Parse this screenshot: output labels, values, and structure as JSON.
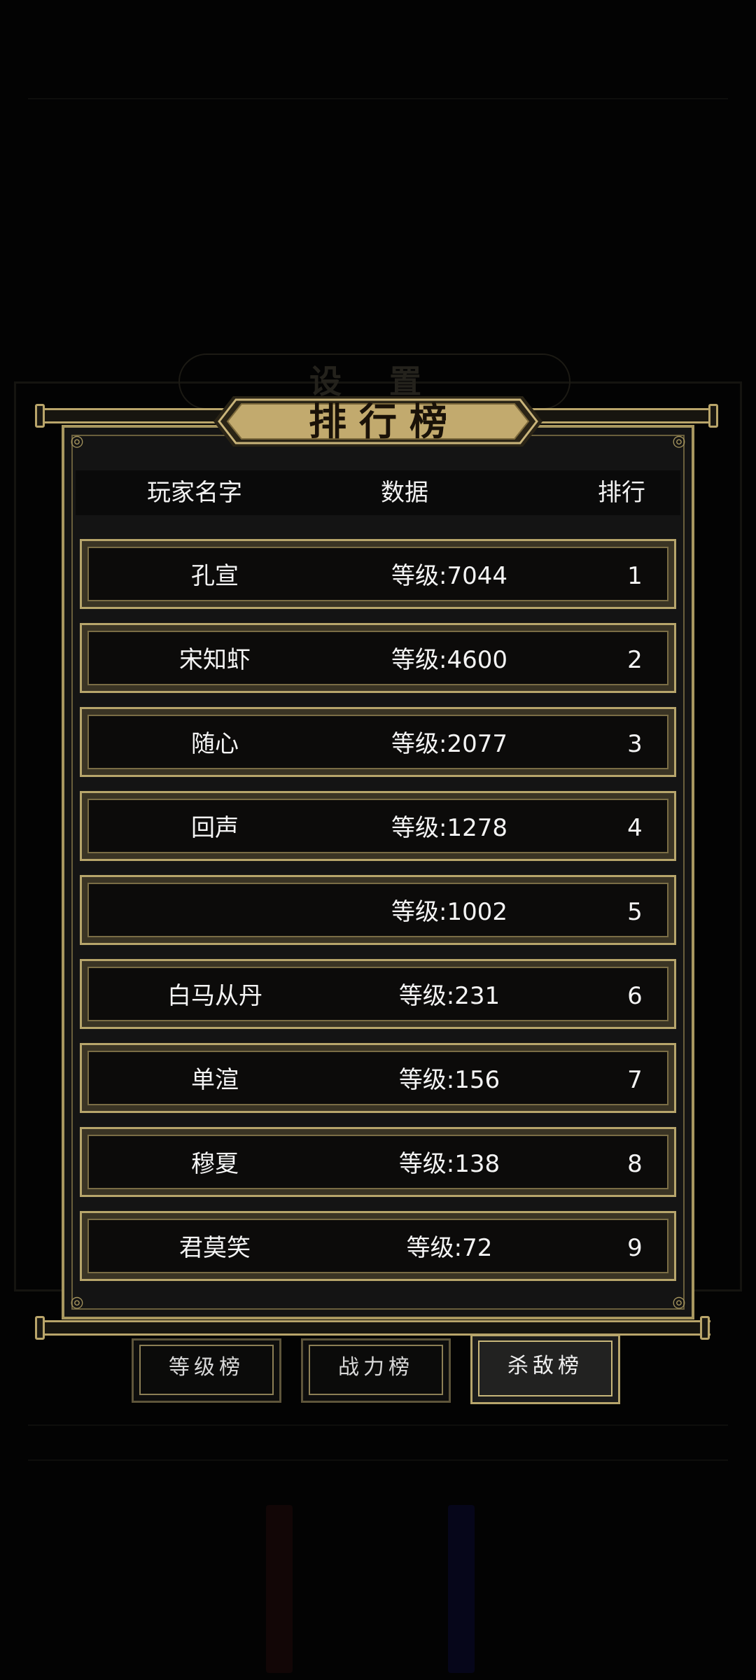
{
  "ghost": {
    "title": "设 置"
  },
  "title": "排行榜",
  "header": {
    "name": "玩家名字",
    "data": "数据",
    "rank": "排行"
  },
  "rows": [
    {
      "name": "孔宣",
      "data": "等级:7044",
      "rank": "1"
    },
    {
      "name": "宋知虾",
      "data": "等级:4600",
      "rank": "2"
    },
    {
      "name": "随心",
      "data": "等级:2077",
      "rank": "3"
    },
    {
      "name": "回声",
      "data": "等级:1278",
      "rank": "4"
    },
    {
      "name": "",
      "data": "等级:1002",
      "rank": "5"
    },
    {
      "name": "白马从丹",
      "data": "等级:231",
      "rank": "6"
    },
    {
      "name": "单渲",
      "data": "等级:156",
      "rank": "7"
    },
    {
      "name": "穆夏",
      "data": "等级:138",
      "rank": "8"
    },
    {
      "name": "君莫笑",
      "data": "等级:72",
      "rank": "9"
    }
  ],
  "tabs": [
    {
      "label": "等级榜",
      "active": false
    },
    {
      "label": "战力榜",
      "active": false
    },
    {
      "label": "杀敌榜",
      "active": true
    }
  ],
  "colors": {
    "gold": "#b7a56b",
    "plaque": "#c2aa6e",
    "background": "#030303"
  }
}
